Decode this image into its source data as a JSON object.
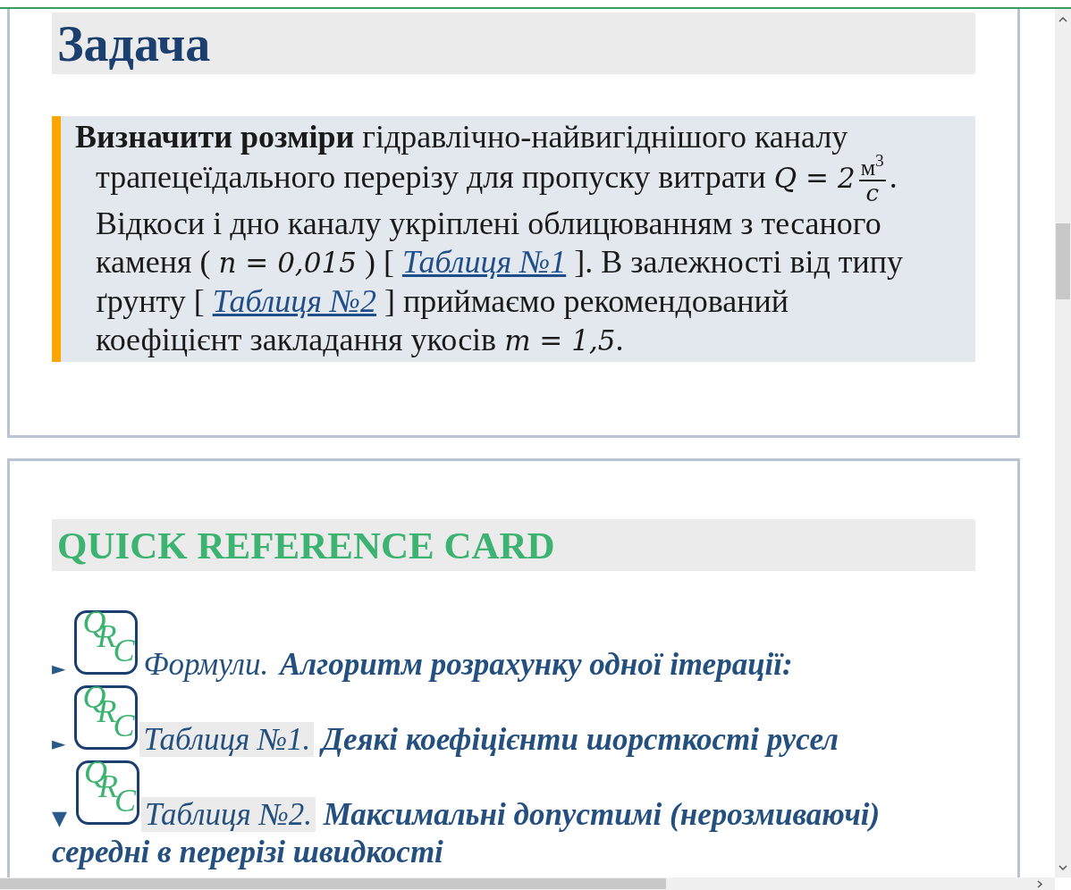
{
  "task": {
    "title": "Задача",
    "paragraph": [
      {
        "kind": "text",
        "text": "**Визначити розміри** гідравлічно-найвигіднішого каналу трапецеїдального перерізу для пропуску витрати "
      },
      {
        "kind": "math",
        "text": "Q = 2"
      },
      {
        "kind": "fraction",
        "numerator": "м$^{3}$",
        "denominator": "с"
      },
      {
        "kind": "text",
        "text": ". Відкоси і дно каналу укріплені облицюванням з тесаного каменя ( "
      },
      {
        "kind": "math",
        "text": "n = 0,015"
      },
      {
        "kind": "text",
        "text": " ) [ "
      },
      {
        "kind": "link",
        "text": "Таблиця №1"
      },
      {
        "kind": "text",
        "text": " ]. В залежності від типу ґрунту [ "
      },
      {
        "kind": "link",
        "text": "Таблиця №2"
      },
      {
        "kind": "text",
        "text": " ] приймаємо рекомендований коефіцієнт закладання укосів "
      },
      {
        "kind": "math",
        "text": "m = 1,5"
      },
      {
        "kind": "text",
        "text": "."
      }
    ]
  },
  "quick_reference": {
    "title": "QUICK REFERENCE CARD",
    "items": [
      {
        "kind": "formula",
        "expanded": false,
        "marker": "►",
        "logo": [
          "Q",
          "R",
          "C"
        ],
        "prefix": "Формули.",
        "title": "Алгоритм розрахунку одної ітерації:"
      },
      {
        "kind": "table",
        "expanded": false,
        "marker": "►",
        "logo": [
          "Q",
          "R",
          "C"
        ],
        "prefix": "Таблиця №1.",
        "title": "Деякі коефіцієнти шорсткості русел"
      },
      {
        "kind": "table",
        "expanded": true,
        "marker": "▼",
        "logo": [
          "Q",
          "R",
          "C"
        ],
        "prefix": "Таблиця №2.",
        "title": "Максимальні допустимі (нерозмиваючі) середні в перерізі швидкості"
      }
    ]
  }
}
